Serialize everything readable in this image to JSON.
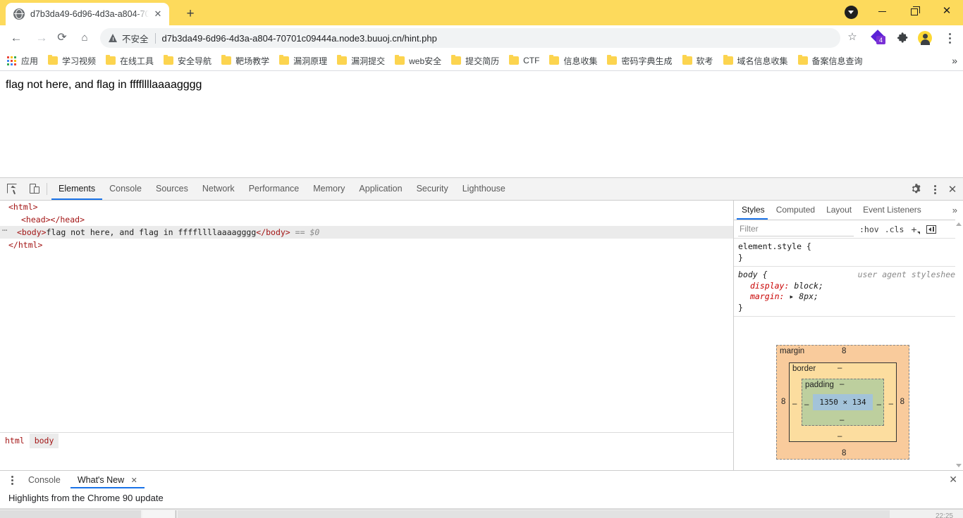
{
  "browser": {
    "tab": {
      "title": "d7b3da49-6d96-4d3a-a804-70",
      "favicon": "globe-icon",
      "close": "✕"
    },
    "new_tab_label": "+",
    "window_controls": {
      "minimize": "–",
      "maximize": "❐",
      "close": "✕"
    },
    "update_badge": "update-available-icon",
    "nav": {
      "back": "←",
      "forward": "→",
      "reload": "⟳",
      "home": "⌂"
    },
    "omnibox": {
      "security_label": "不安全",
      "url": "d7b3da49-6d96-4d3a-a804-70701c09444a.node3.buuoj.cn/hint.php",
      "star": "☆"
    },
    "extensions": {
      "badge_count": "4",
      "puzzle": "extensions-icon"
    },
    "menu": "three-dot-menu-icon",
    "bookmarks": {
      "apps_label": "应用",
      "items": [
        {
          "label": "学习视频"
        },
        {
          "label": "在线工具"
        },
        {
          "label": "安全导航"
        },
        {
          "label": "靶场教学"
        },
        {
          "label": "漏洞原理"
        },
        {
          "label": "漏洞提交"
        },
        {
          "label": "web安全"
        },
        {
          "label": "提交简历"
        },
        {
          "label": "CTF"
        },
        {
          "label": "信息收集"
        },
        {
          "label": "密码字典生成"
        },
        {
          "label": "软考"
        },
        {
          "label": "域名信息收集"
        },
        {
          "label": "备案信息查询"
        }
      ],
      "overflow": "»"
    }
  },
  "page": {
    "body_text": "flag not here, and flag in ffffllllaaaagggg"
  },
  "devtools": {
    "tabs": [
      {
        "label": "Elements",
        "active": true
      },
      {
        "label": "Console",
        "active": false
      },
      {
        "label": "Sources",
        "active": false
      },
      {
        "label": "Network",
        "active": false
      },
      {
        "label": "Performance",
        "active": false
      },
      {
        "label": "Memory",
        "active": false
      },
      {
        "label": "Application",
        "active": false
      },
      {
        "label": "Security",
        "active": false
      },
      {
        "label": "Lighthouse",
        "active": false
      }
    ],
    "toolbar": {
      "inspect": "inspect-element-icon",
      "device": "device-toolbar-icon",
      "settings": "gear-icon",
      "more": "three-dot-menu-icon",
      "close": "✕"
    },
    "dom": {
      "line1": "<html>",
      "line2": "<head></head>",
      "body_open": "<body>",
      "body_text": "flag not here, and flag in ffffllllaaaagggg",
      "body_close": "</body>",
      "selected_marker": "== $0",
      "expand_dots": "…",
      "line4": "</html>"
    },
    "breadcrumb": [
      {
        "label": "html",
        "active": false
      },
      {
        "label": "body",
        "active": true
      }
    ],
    "styles": {
      "tabs": [
        {
          "label": "Styles",
          "active": true
        },
        {
          "label": "Computed",
          "active": false
        },
        {
          "label": "Layout",
          "active": false
        },
        {
          "label": "Event Listeners",
          "active": false
        }
      ],
      "more": "»",
      "filter_placeholder": "Filter",
      "filter_value": "",
      "hov": ":hov",
      "cls": ".cls",
      "plus": "+",
      "box_toggle": "toggle-element-state-icon",
      "rules": [
        {
          "selector": "element.style {",
          "origin": "",
          "declarations": [],
          "close": "}"
        },
        {
          "selector": "body {",
          "origin": "user agent stylesheet",
          "declarations": [
            {
              "property": "display:",
              "value": "block;"
            },
            {
              "property": "margin:",
              "value": "▸ 8px;"
            }
          ],
          "close": "}"
        }
      ],
      "box_model": {
        "margin_label": "margin",
        "border_label": "border",
        "padding_label": "padding",
        "content": "1350 × 134",
        "margin_top": "8",
        "margin_right": "8",
        "margin_bottom": "8",
        "margin_left": "8",
        "border_top": "–",
        "border_right": "–",
        "border_bottom": "–",
        "border_left": "–",
        "padding_top": "–",
        "padding_right": "–",
        "padding_bottom": "–",
        "padding_left": "–"
      }
    },
    "drawer": {
      "more": "three-dot-menu-icon",
      "tabs": [
        {
          "label": "Console",
          "active": false
        },
        {
          "label": "What's New",
          "active": true
        }
      ],
      "tab_close": "✕",
      "drawer_close": "✕",
      "content_text": "Highlights from the Chrome 90 update"
    }
  },
  "taskbar": {
    "time": "22:25"
  },
  "colors": {
    "titlebar": "#fdda5c",
    "accent": "#1a73e8",
    "folder": "#fcd44f",
    "margin_box": "#f9cb9c",
    "border_box": "#fcdd9f",
    "padding_box": "#bdcf9e",
    "content_box": "#a3c3d9"
  }
}
